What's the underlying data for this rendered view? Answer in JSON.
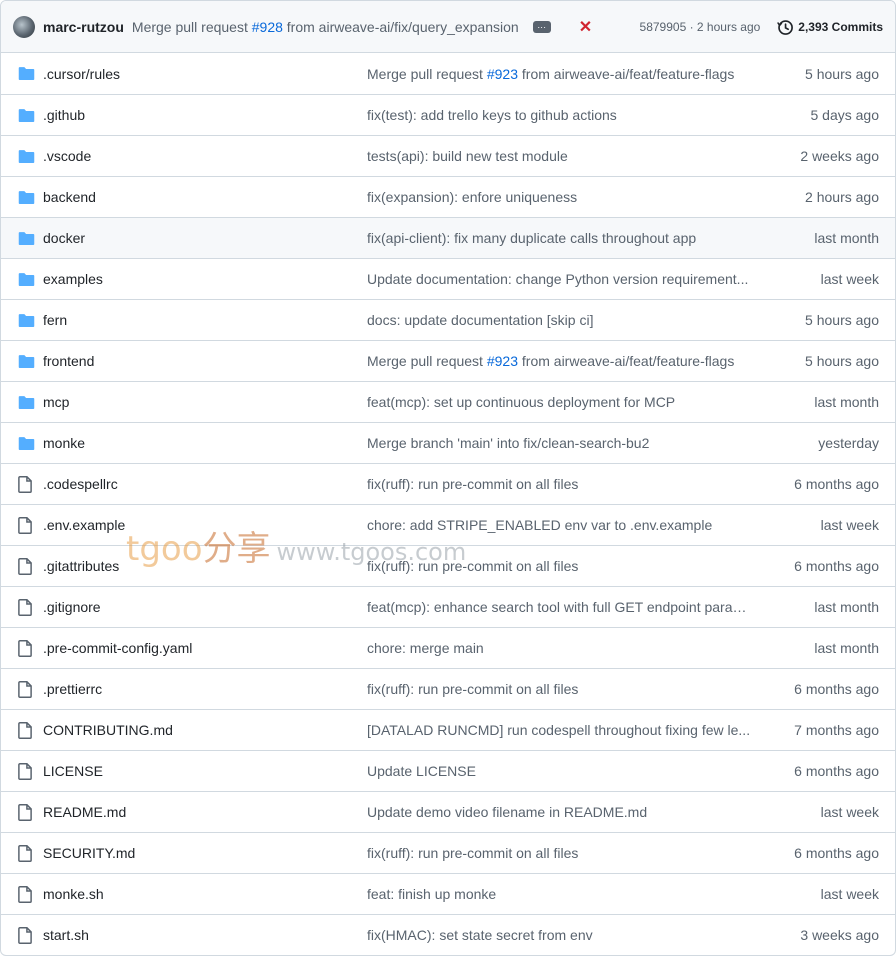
{
  "header": {
    "author": "marc-rutzou",
    "commit_prefix": "Merge pull request ",
    "commit_pr": "#928",
    "commit_suffix": " from airweave-ai/fix/query_expansion",
    "ellipsis": "···",
    "status": "✕",
    "sha_time": "5879905 · 2 hours ago",
    "commits_count": "2,393 Commits"
  },
  "colors": {
    "folder": "#54aeff",
    "file": "#59636e",
    "link": "#0969da",
    "status_fail": "#d1242f"
  },
  "rows": [
    {
      "type": "folder",
      "name": ".cursor/rules",
      "msg_prefix": "Merge pull request ",
      "msg_link": "#923",
      "msg": " from airweave-ai/feat/feature-flags",
      "time": "5 hours ago"
    },
    {
      "type": "folder",
      "name": ".github",
      "msg_prefix": "",
      "msg_link": "",
      "msg": "fix(test): add trello keys to github actions",
      "time": "5 days ago"
    },
    {
      "type": "folder",
      "name": ".vscode",
      "msg_prefix": "",
      "msg_link": "",
      "msg": "tests(api): build new test module",
      "time": "2 weeks ago"
    },
    {
      "type": "folder",
      "name": "backend",
      "msg_prefix": "",
      "msg_link": "",
      "msg": "fix(expansion): enfore uniqueness",
      "time": "2 hours ago"
    },
    {
      "type": "folder",
      "name": "docker",
      "msg_prefix": "",
      "msg_link": "",
      "msg": "fix(api-client): fix many duplicate calls throughout app",
      "time": "last month"
    },
    {
      "type": "folder",
      "name": "examples",
      "msg_prefix": "",
      "msg_link": "",
      "msg": "Update documentation: change Python version requirement...",
      "time": "last week"
    },
    {
      "type": "folder",
      "name": "fern",
      "msg_prefix": "",
      "msg_link": "",
      "msg": "docs: update documentation [skip ci]",
      "time": "5 hours ago"
    },
    {
      "type": "folder",
      "name": "frontend",
      "msg_prefix": "Merge pull request ",
      "msg_link": "#923",
      "msg": " from airweave-ai/feat/feature-flags",
      "time": "5 hours ago"
    },
    {
      "type": "folder",
      "name": "mcp",
      "msg_prefix": "",
      "msg_link": "",
      "msg": "feat(mcp): set up continuous deployment for MCP",
      "time": "last month"
    },
    {
      "type": "folder",
      "name": "monke",
      "msg_prefix": "",
      "msg_link": "",
      "msg": "Merge branch 'main' into fix/clean-search-bu2",
      "time": "yesterday"
    },
    {
      "type": "file",
      "name": ".codespellrc",
      "msg_prefix": "",
      "msg_link": "",
      "msg": "fix(ruff): run pre-commit on all files",
      "time": "6 months ago"
    },
    {
      "type": "file",
      "name": ".env.example",
      "msg_prefix": "",
      "msg_link": "",
      "msg": "chore: add STRIPE_ENABLED env var to .env.example",
      "time": "last week"
    },
    {
      "type": "file",
      "name": ".gitattributes",
      "msg_prefix": "",
      "msg_link": "",
      "msg": "fix(ruff): run pre-commit on all files",
      "time": "6 months ago"
    },
    {
      "type": "file",
      "name": ".gitignore",
      "msg_prefix": "",
      "msg_link": "",
      "msg": "feat(mcp): enhance search tool with full GET endpoint param...",
      "time": "last month"
    },
    {
      "type": "file",
      "name": ".pre-commit-config.yaml",
      "msg_prefix": "",
      "msg_link": "",
      "msg": "chore: merge main",
      "time": "last month"
    },
    {
      "type": "file",
      "name": ".prettierrc",
      "msg_prefix": "",
      "msg_link": "",
      "msg": "fix(ruff): run pre-commit on all files",
      "time": "6 months ago"
    },
    {
      "type": "file",
      "name": "CONTRIBUTING.md",
      "msg_prefix": "",
      "msg_link": "",
      "msg": "[DATALAD RUNCMD] run codespell throughout fixing few le...",
      "time": "7 months ago"
    },
    {
      "type": "file",
      "name": "LICENSE",
      "msg_prefix": "",
      "msg_link": "",
      "msg": "Update LICENSE",
      "time": "6 months ago"
    },
    {
      "type": "file",
      "name": "README.md",
      "msg_prefix": "",
      "msg_link": "",
      "msg": "Update demo video filename in README.md",
      "time": "last week"
    },
    {
      "type": "file",
      "name": "SECURITY.md",
      "msg_prefix": "",
      "msg_link": "",
      "msg": "fix(ruff): run pre-commit on all files",
      "time": "6 months ago"
    },
    {
      "type": "file",
      "name": "monke.sh",
      "msg_prefix": "",
      "msg_link": "",
      "msg": "feat: finish up monke",
      "time": "last week"
    },
    {
      "type": "file",
      "name": "start.sh",
      "msg_prefix": "",
      "msg_link": "",
      "msg": "fix(HMAC): set state secret from env",
      "time": "3 weeks ago"
    }
  ],
  "watermark": {
    "brand": "tgoo",
    "cn": "分享",
    "url": "www.tgoos.com"
  }
}
